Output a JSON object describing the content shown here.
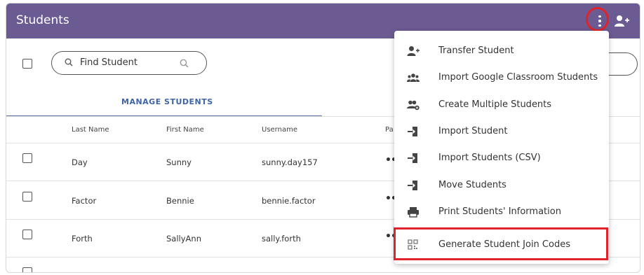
{
  "header": {
    "title": "Students"
  },
  "search": {
    "value": "Find Student"
  },
  "tab": {
    "label": "MANAGE STUDENTS"
  },
  "table": {
    "columns": [
      "Last Name",
      "First Name",
      "Username",
      "Pa"
    ],
    "rows": [
      {
        "last": "Day",
        "first": "Sunny",
        "username": "sunny.day157",
        "dots": "•••"
      },
      {
        "last": "Factor",
        "first": "Bennie",
        "username": "bennie.factor",
        "dots": "•••"
      },
      {
        "last": "Forth",
        "first": "SallyAnn",
        "username": "sally.forth",
        "dots": "•••"
      }
    ]
  },
  "menu": {
    "items": [
      {
        "label": "Transfer Student",
        "icon": "user-plus-icon"
      },
      {
        "label": "Import Google Classroom Students",
        "icon": "users-group-icon"
      },
      {
        "label": "Create Multiple Students",
        "icon": "users-add-icon"
      },
      {
        "label": "Import Student",
        "icon": "import-icon"
      },
      {
        "label": "Import Students (CSV)",
        "icon": "import-icon"
      },
      {
        "label": "Move Students",
        "icon": "import-icon"
      },
      {
        "label": "Print Students' Information",
        "icon": "printer-icon"
      },
      {
        "label": "Generate Student Join Codes",
        "icon": "qr-code-icon"
      }
    ]
  },
  "colors": {
    "header": "#6c5b92",
    "accent": "#3f64a8",
    "highlight": "#e0232a"
  }
}
